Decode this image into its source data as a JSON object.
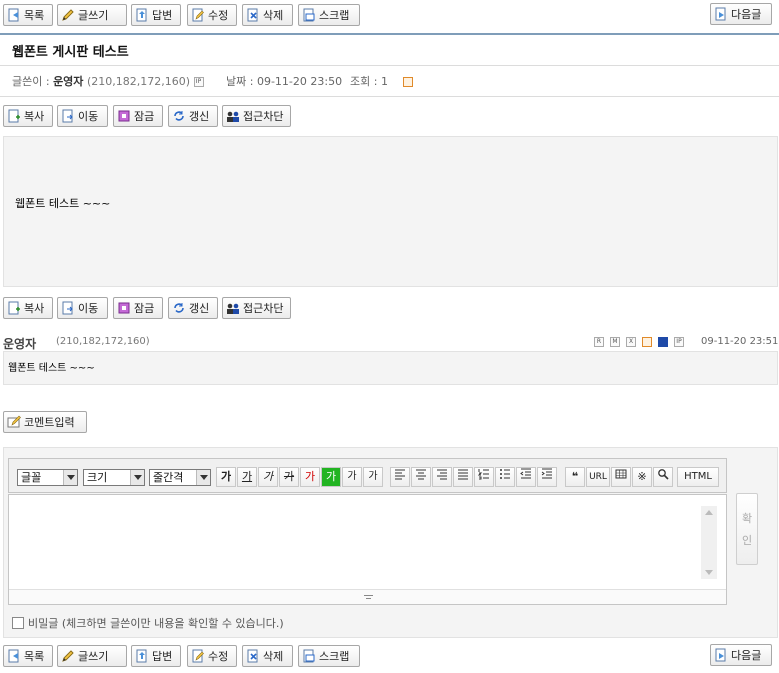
{
  "toolbar": {
    "list": "목록",
    "write": "글쓰기",
    "reply": "답변",
    "edit": "수정",
    "delete": "삭제",
    "scrap": "스크랩",
    "next": "다음글"
  },
  "post": {
    "title": "웹폰트 게시판 테스트",
    "author_label": "글쓴이 :",
    "author": "운영자",
    "ip": "(210,182,172,160)",
    "date_label": "날짜 :",
    "date": "09-11-20 23:50",
    "views_label": "조회 :",
    "views": "1",
    "body": "웹폰트 테스트 ~~~"
  },
  "admin": {
    "copy": "복사",
    "move": "이동",
    "lock": "잠금",
    "refresh": "갱신",
    "block": "접근차단"
  },
  "comment": {
    "author": "운영자",
    "ip": "(210,182,172,160)",
    "date": "09-11-20 23:51",
    "text": "웹폰트 테스트 ~~~",
    "tags": [
      "R",
      "M",
      "X",
      "IP"
    ]
  },
  "comment_form": {
    "button": "코멘트입력",
    "font_select": "글꼴",
    "size_select": "크기",
    "spacing_select": "줄간격",
    "fmt": [
      "가",
      "가",
      "가",
      "가",
      "가",
      "가",
      "가",
      "가"
    ],
    "url": "URL",
    "html": "HTML",
    "confirm_1": "확",
    "confirm_2": "인",
    "secret_label": "비밀글 (체크하면 글쓴이만 내용을 확인할 수 있습니다.)"
  },
  "colors": {
    "accent_line": "#7f9db9",
    "panel_bg": "#f4f4f4",
    "highlight_green": "#22b422",
    "red_text": "#d00000"
  }
}
